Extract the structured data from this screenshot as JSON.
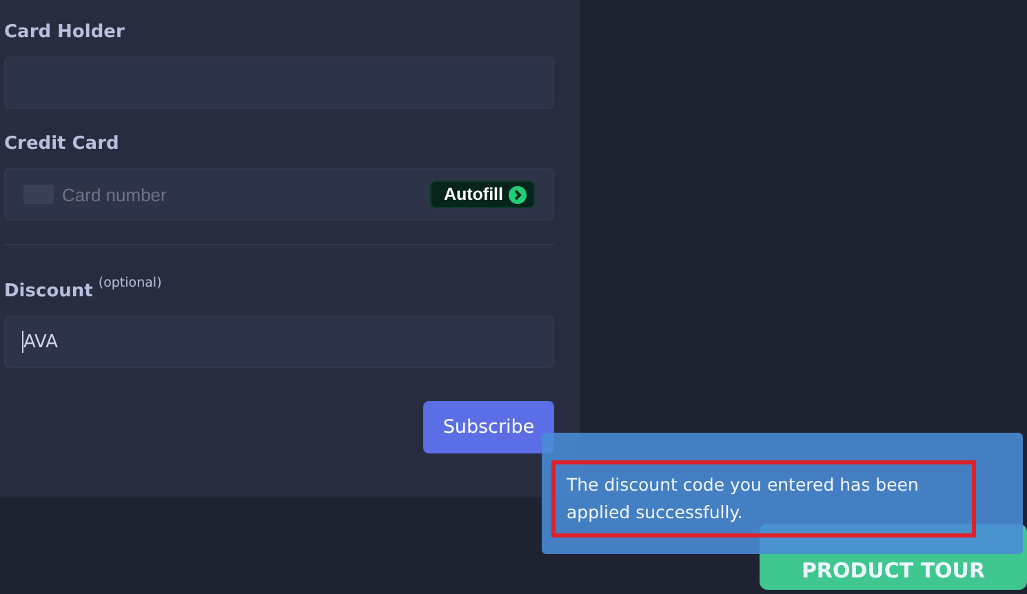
{
  "form": {
    "fields": [
      {
        "kind": "text",
        "label": "Card Holder"
      },
      {
        "kind": "card",
        "label": "Credit Card",
        "placeholder": "Card number",
        "action": "Autofill"
      },
      {
        "kind": "discount",
        "label": "Discount",
        "note": "(optional)",
        "value": "AVA"
      }
    ],
    "submit": "Subscribe"
  },
  "toast": {
    "message": "The discount code you entered has been applied successfully.",
    "highlighted": true
  },
  "tour_button": "PRODUCT TOUR"
}
